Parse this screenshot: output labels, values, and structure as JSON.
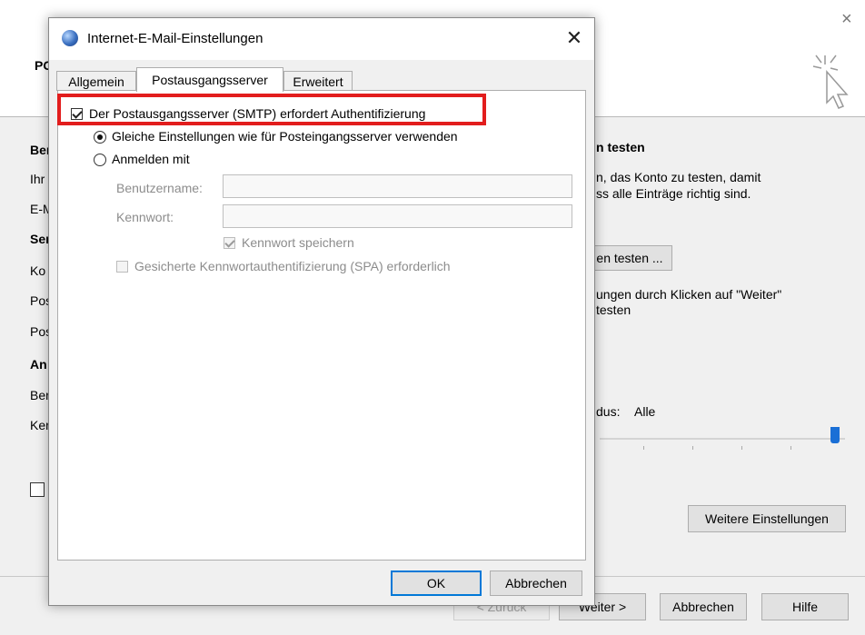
{
  "background": {
    "header_text": "PC",
    "section_left": "Ber",
    "rows_left": [
      "Ihr",
      "E-M",
      "Ser",
      "Ko",
      "Pos",
      "Pos",
      "An",
      "Ber",
      "Ker"
    ],
    "test_heading": "n testen",
    "test_description_1": "n, das Konto zu testen, damit",
    "test_description_2": "ss alle Einträge richtig sind.",
    "test_button": "en testen ...",
    "auto_test_1": "ungen durch Klicken auf \"Weiter\"",
    "auto_test_2": "testen",
    "mode_label": "dus:",
    "mode_value": "Alle",
    "more_settings": "Weitere Einstellungen",
    "back_button": "< Zurück",
    "next_button": "Weiter >",
    "cancel_button": "Abbrechen",
    "help_button": "Hilfe",
    "close_glyph": "×"
  },
  "dialog": {
    "title": "Internet-E-Mail-Einstellungen",
    "close_glyph": "✕",
    "tabs": [
      {
        "label": "Allgemein",
        "active": false
      },
      {
        "label": "Postausgangsserver",
        "active": true
      },
      {
        "label": "Erweitert",
        "active": false
      }
    ],
    "smtp_auth_label": "Der Postausgangsserver (SMTP) erfordert Authentifizierung",
    "smtp_auth_checked": true,
    "same_settings_label": "Gleiche Einstellungen wie für Posteingangsserver verwenden",
    "login_with_label": "Anmelden mit",
    "username_label": "Benutzername:",
    "username_value": "",
    "password_label": "Kennwort:",
    "password_value": "",
    "remember_password_label": "Kennwort speichern",
    "spa_label": "Gesicherte Kennwortauthentifizierung (SPA) erforderlich",
    "ok_button": "OK",
    "cancel_button": "Abbrechen"
  },
  "colors": {
    "highlight": "#e21d1d",
    "slider_thumb": "#1a6fd6"
  }
}
